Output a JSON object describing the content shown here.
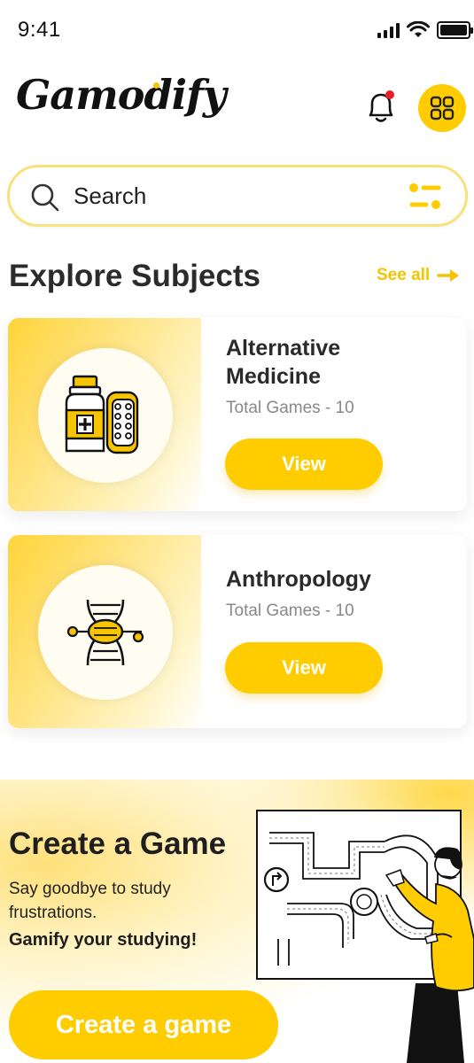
{
  "status_bar": {
    "time": "9:41"
  },
  "header": {
    "logo_text": "Gamodify"
  },
  "search": {
    "placeholder": "Search"
  },
  "explore": {
    "title": "Explore Subjects",
    "see_all": "See all"
  },
  "subjects": [
    {
      "title_line1": "Alternative",
      "title_line2": "Medicine",
      "total_games": "Total Games - 10",
      "button": "View"
    },
    {
      "title_line1": "Anthropology",
      "total_games": "Total Games - 10",
      "button": "View"
    }
  ],
  "create": {
    "title": "Create a Game",
    "description": "Say goodbye to study frustrations.",
    "tagline": "Gamify your studying!",
    "button": "Create a game"
  },
  "colors": {
    "accent": "#ffcc00",
    "notification": "#e8202a"
  }
}
